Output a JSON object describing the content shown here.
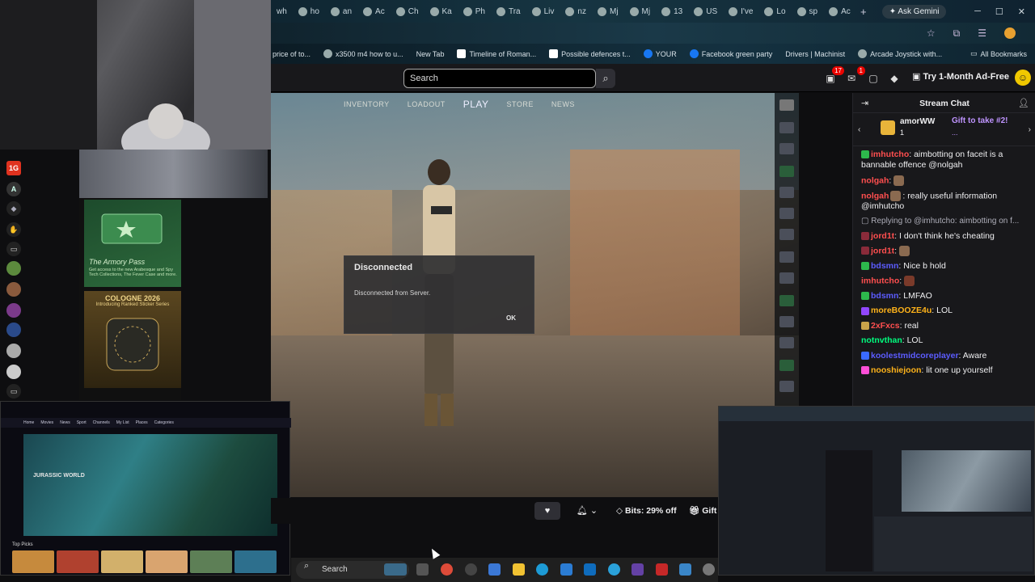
{
  "browser": {
    "tabs": [
      "wh",
      "ho",
      "an",
      "Ac",
      "Ch",
      "Ka",
      "Ph",
      "Tra",
      "Liv",
      "nz",
      "Mj",
      "Mj",
      "13",
      "US",
      "I've",
      "Lo",
      "sp",
      "Ac"
    ],
    "new_tab": "+",
    "gemini": "Ask Gemini"
  },
  "bookmarks": {
    "items": [
      "price of to...",
      "x3500 m4 how to u...",
      "New Tab",
      "Timeline of Roman...",
      "Possible defences t...",
      "YOUR",
      "Facebook green party",
      "Drivers | Machinist",
      "Arcade Joystick with..."
    ],
    "all": "All Bookmarks"
  },
  "twitch": {
    "search_placeholder": "Search",
    "notif_count": "17",
    "inbox_count": "1",
    "adfree": "Try 1-Month Ad-Free"
  },
  "game": {
    "menu": [
      "INVENTORY",
      "LOADOUT",
      "PLAY",
      "STORE",
      "NEWS"
    ],
    "dialog": {
      "title": "Disconnected",
      "body": "Disconnected from Server.",
      "ok": "OK"
    }
  },
  "promo": {
    "armory_title": "The Armory Pass",
    "armory_desc": "Get access to the new Arabesque and Spy Tech Collections, The Fever Case and more.",
    "cologne_title": "COLOGNE 2026",
    "cologne_sub": "Introducing Ranked Sticker Series"
  },
  "thumb_browser": {
    "nav": [
      "Home",
      "Movies",
      "News",
      "Sport",
      "Channels",
      "My List",
      "Places",
      "Categories"
    ],
    "title": "JURASSIC WORLD",
    "toppicks": "Top Picks"
  },
  "player": {
    "bits": "Bits: 29% off",
    "gift": "Gift"
  },
  "chat": {
    "title": "Stream Chat",
    "pinned_user": "amorWW",
    "pinned_count": "1",
    "pinned_gift": "Gift to take #2!",
    "pinned_more": "...",
    "messages": [
      {
        "user": "imhutcho",
        "color": "#ff4f4f",
        "text": ": aimbotting on faceit is a bannable offence @nolgah"
      },
      {
        "user": "nolgah",
        "color": "#ff4f4f",
        "text": ":"
      },
      {
        "user": "nolgah",
        "color": "#ff4f4f",
        "text": ": really useful information @imhutcho"
      },
      {
        "reply": "Replying to @imhutcho: aimbotting on f..."
      },
      {
        "user": "jord1t",
        "color": "#ff4f4f",
        "text": ": I don't think he's cheating"
      },
      {
        "user": "jord1t",
        "color": "#ff4f4f",
        "text": ":"
      },
      {
        "user": "bdsmn",
        "color": "#5c5cff",
        "text": ": Nice b hold"
      },
      {
        "user": "imhutcho",
        "color": "#ff4f4f",
        "text": ":"
      },
      {
        "user": "bdsmn",
        "color": "#5c5cff",
        "text": ": LMFAO"
      },
      {
        "user": "moreBOOZE4u",
        "color": "#ffb31a",
        "text": ": LOL"
      },
      {
        "user": "2xFxcs",
        "color": "#ff4f4f",
        "text": ": real"
      },
      {
        "user": "notnvthan",
        "color": "#00ff7f",
        "text": ": LOL"
      },
      {
        "user": "koolestmidcoreplayer",
        "color": "#5c5cff",
        "text": ": Aware"
      },
      {
        "user": "nooshiejoon",
        "color": "#ffb31a",
        "text": ": lit one up yourself"
      }
    ]
  },
  "taskbar": {
    "search": "Search"
  }
}
